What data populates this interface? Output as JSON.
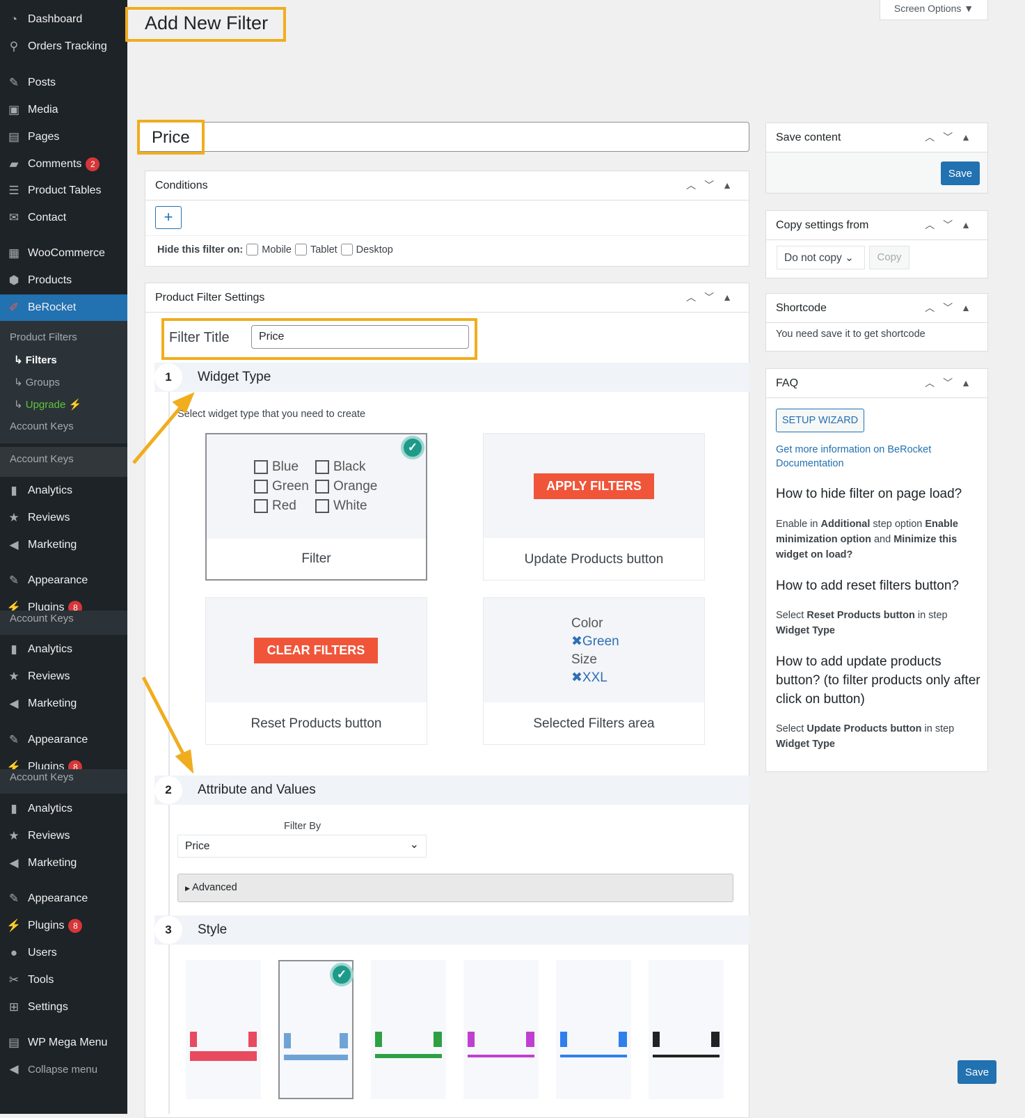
{
  "sidebar": {
    "items": [
      {
        "label": "Dashboard",
        "icon": "dashboard-icon"
      },
      {
        "label": "Orders Tracking",
        "icon": "location-icon"
      },
      {
        "label": "Posts",
        "icon": "pin-icon"
      },
      {
        "label": "Media",
        "icon": "media-icon"
      },
      {
        "label": "Pages",
        "icon": "pages-icon"
      },
      {
        "label": "Comments",
        "badge": "2",
        "icon": "comment-icon"
      },
      {
        "label": "Product Tables",
        "icon": "list-icon"
      },
      {
        "label": "Contact",
        "icon": "mail-icon"
      },
      {
        "label": "WooCommerce",
        "icon": "woo-icon"
      },
      {
        "label": "Products",
        "icon": "box-icon"
      },
      {
        "label": "BeRocket",
        "icon": "rocket-icon"
      },
      {
        "label": "Analytics",
        "icon": "chart-icon"
      },
      {
        "label": "Reviews",
        "icon": "star-icon"
      },
      {
        "label": "Marketing",
        "icon": "megaphone-icon"
      },
      {
        "label": "Appearance",
        "icon": "brush-icon"
      },
      {
        "label": "Plugins",
        "badge": "8",
        "icon": "plug-icon"
      },
      {
        "label": "Users",
        "icon": "user-icon"
      },
      {
        "label": "Tools",
        "icon": "wrench-icon"
      },
      {
        "label": "Settings",
        "icon": "settings-icon"
      },
      {
        "label": "WP Mega Menu",
        "icon": "menu-icon"
      },
      {
        "label": "Collapse menu",
        "icon": "collapse-icon"
      }
    ],
    "submenu": {
      "header": "Product Filters",
      "filters": "Filters",
      "groups": "Groups",
      "upgrade": "Upgrade",
      "account_keys": "Account Keys",
      "arrow": "↳",
      "bolt": "⚡"
    }
  },
  "header": {
    "title": "Add New Filter",
    "screen_options": "Screen Options ▼"
  },
  "post_title": "Price",
  "conditions": {
    "title": "Conditions",
    "add": "+",
    "hide_label": "Hide this filter on:",
    "mobile": "Mobile",
    "tablet": "Tablet",
    "desktop": "Desktop"
  },
  "settings": {
    "title": "Product Filter Settings",
    "filter_title_label": "Filter Title",
    "filter_title_value": "Price",
    "step1": {
      "num": "1",
      "title": "Widget Type",
      "hint": "Select widget type that you need to create"
    },
    "widgets": {
      "filter": {
        "label": "Filter",
        "options": [
          "Blue",
          "Black",
          "Green",
          "Orange",
          "Red",
          "White"
        ]
      },
      "update": {
        "label": "Update Products button",
        "button": "APPLY FILTERS"
      },
      "reset": {
        "label": "Reset Products button",
        "button": "CLEAR FILTERS"
      },
      "selected": {
        "label": "Selected Filters area",
        "lines": [
          "Color",
          "✖Green",
          "Size",
          "✖XXL"
        ]
      }
    },
    "step2": {
      "num": "2",
      "title": "Attribute and Values",
      "filter_by_label": "Filter By",
      "filter_by_value": "Price",
      "advanced": "Advanced"
    },
    "step3": {
      "num": "3",
      "title": "Style"
    },
    "styles": [
      {
        "color": "#e84a5f",
        "selected": false
      },
      {
        "color": "#6fa3d6",
        "selected": true
      },
      {
        "color": "#2ea043",
        "selected": false
      },
      {
        "color": "#c13fd0",
        "selected": false
      },
      {
        "color": "#2f80ed",
        "selected": false
      },
      {
        "color": "#222222",
        "selected": false
      }
    ]
  },
  "right": {
    "save": {
      "title": "Save content",
      "button": "Save"
    },
    "copy": {
      "title": "Copy settings from",
      "select": "Do not copy",
      "button": "Copy"
    },
    "shortcode": {
      "title": "Shortcode",
      "text": "You need save it to get shortcode"
    },
    "faq": {
      "title": "FAQ",
      "wizard": "SETUP WIZARD",
      "link": "Get more information on BeRocket Documentation",
      "q1": "How to hide filter on page load?",
      "a1": [
        "Enable in ",
        "Additional",
        " step option ",
        "Enable minimization option",
        " and ",
        "Minimize this widget on load?"
      ],
      "q2": "How to add reset filters button?",
      "a2": [
        "Select ",
        "Reset Products button",
        " in step ",
        "Widget Type"
      ],
      "q3": "How to add update products button? (to filter products only after click on button)",
      "a3": [
        "Select ",
        "Update Products button",
        " in step ",
        "Widget Type"
      ]
    }
  },
  "footer_save": "Save",
  "colors": {
    "accent": "#2271b1",
    "highlight": "#f0ad1e",
    "red_button": "#f0553a",
    "check": "#1d9a8a"
  }
}
